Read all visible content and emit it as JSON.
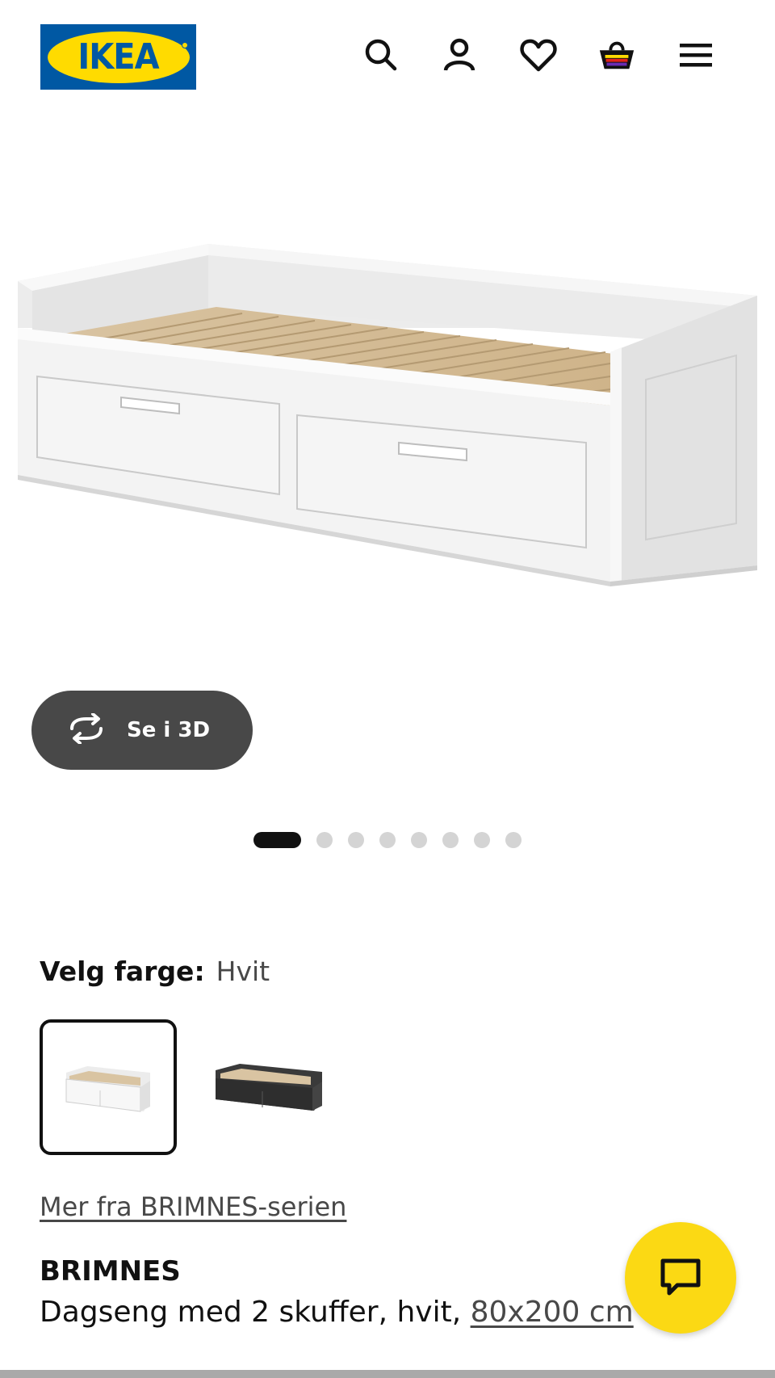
{
  "header": {
    "logo_text": "IKEA",
    "icons": [
      "search-icon",
      "user-icon",
      "heart-icon",
      "basket-icon",
      "menu-icon"
    ]
  },
  "gallery": {
    "view_3d_label": "Se i 3D",
    "slide_count": 8,
    "active_slide": 1
  },
  "color": {
    "label": "Velg farge:",
    "value": "Hvit",
    "options": [
      "Hvit",
      "Svart"
    ]
  },
  "series_link": "Mer fra BRIMNES-serien",
  "product": {
    "name": "BRIMNES",
    "description": "Dagseng med 2 skuffer, hvit, ",
    "size": "80x200 cm"
  },
  "colors": {
    "ikea_blue": "#0058a3",
    "ikea_yellow": "#ffdb00",
    "chat_yellow": "#fbd914",
    "button_dark": "#484848"
  }
}
